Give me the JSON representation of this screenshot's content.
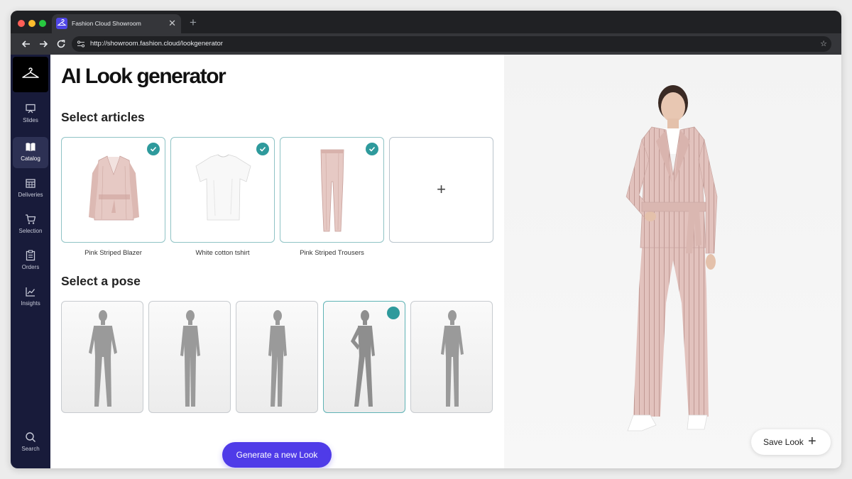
{
  "browser": {
    "tab_title": "Fashion Cloud Showroom",
    "tab_close": "✕",
    "new_tab": "+",
    "url": "http://showroom.fashion.cloud/lookgenerator",
    "star": "☆"
  },
  "sidebar": {
    "logo_icon": "hanger-icon",
    "items": [
      {
        "label": "Slides",
        "icon": "presentation-icon",
        "active": false
      },
      {
        "label": "Catalog",
        "icon": "book-icon",
        "active": true
      },
      {
        "label": "Deliveries",
        "icon": "calendar-icon",
        "active": false
      },
      {
        "label": "Selection",
        "icon": "cart-icon",
        "active": false
      },
      {
        "label": "Orders",
        "icon": "clipboard-icon",
        "active": false
      },
      {
        "label": "Insights",
        "icon": "chart-icon",
        "active": false
      },
      {
        "label": "Search",
        "icon": "search-icon",
        "active": false
      }
    ]
  },
  "main": {
    "title": "AI Look generator",
    "articles_heading": "Select articles",
    "articles": [
      {
        "label": "Pink Striped Blazer",
        "selected": true
      },
      {
        "label": "White cotton tshirt",
        "selected": true
      },
      {
        "label": "Pink Striped Trousers",
        "selected": true
      }
    ],
    "add_article": "+",
    "pose_heading": "Select a pose",
    "poses_selected_index": 3,
    "generate_label": "Generate a new Look"
  },
  "preview": {
    "save_label": "Save Look",
    "save_plus": "+"
  },
  "colors": {
    "accent": "#4f3be8",
    "check": "#2e9a9c",
    "sidebar": "#181b3a",
    "suit_pink": "#e2c2bd"
  }
}
